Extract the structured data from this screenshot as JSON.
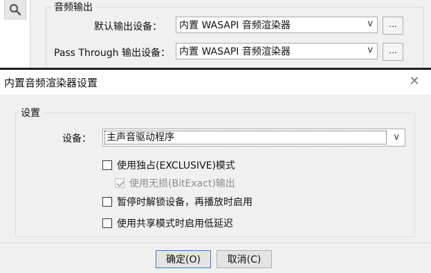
{
  "background": {
    "search_icon": "search-icon",
    "audio_output_group": "音频输出",
    "default_device_label": "默认输出设备：",
    "default_device_value": "内置 WASAPI 音频渲染器",
    "passthrough_label": "Pass Through 输出设备：",
    "passthrough_value": "内置 WASAPI 音频渲染器",
    "dropdown_arrow": "v",
    "browse_label": "..."
  },
  "dialog": {
    "title": "内置音频渲染器设置",
    "close_glyph": "✕",
    "settings_group": "设置",
    "device_label": "设备：",
    "device_value": "主声音驱动程序",
    "dropdown_arrow": "v",
    "options": [
      {
        "label": "使用独占(EXCLUSIVE)模式",
        "checked": false,
        "enabled": true
      },
      {
        "label": "使用无损(BitExact)输出",
        "checked": true,
        "enabled": false
      },
      {
        "label": "暂停时解锁设备，再播放时启用",
        "checked": false,
        "enabled": true
      },
      {
        "label": "使用共享模式时启用低延迟",
        "checked": false,
        "enabled": true
      }
    ],
    "ok_label": "确定(O)",
    "cancel_label": "取消(C)"
  }
}
